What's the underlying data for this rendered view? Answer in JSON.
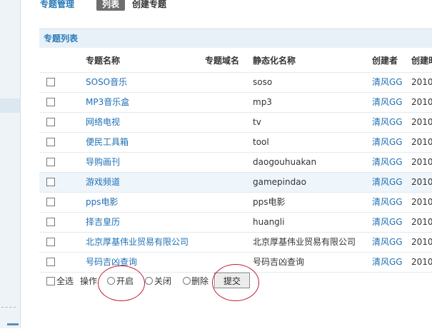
{
  "header": {
    "title": "专题管理",
    "tab_list": "列表",
    "tab_create": "创建专题"
  },
  "panel": {
    "title": "专题列表"
  },
  "table": {
    "columns": {
      "name": "专题名称",
      "domain": "专题域名",
      "static": "静态化名称",
      "creator": "创建者",
      "time": "创建时"
    },
    "rows": [
      {
        "name": "SOSO音乐",
        "domain": "",
        "static": "soso",
        "creator": "清风GG",
        "time": "2010"
      },
      {
        "name": "MP3音乐盒",
        "domain": "",
        "static": "mp3",
        "creator": "清风GG",
        "time": "2010"
      },
      {
        "name": "网络电视",
        "domain": "",
        "static": "tv",
        "creator": "清风GG",
        "time": "2010"
      },
      {
        "name": "便民工具箱",
        "domain": "",
        "static": "tool",
        "creator": "清风GG",
        "time": "2010"
      },
      {
        "name": "导购画刊",
        "domain": "",
        "static": "daogouhuakan",
        "creator": "清风GG",
        "time": "2010"
      },
      {
        "name": "游戏频道",
        "domain": "",
        "static": "gamepindao",
        "creator": "清风GG",
        "time": "2010"
      },
      {
        "name": "pps电影",
        "domain": "",
        "static": "pps电影",
        "creator": "清风GG",
        "time": "2010"
      },
      {
        "name": "择吉皇历",
        "domain": "",
        "static": "huangli",
        "creator": "清风GG",
        "time": "2010"
      },
      {
        "name": "北京厚基伟业贸易有限公司",
        "domain": "",
        "static": "北京厚基伟业贸易有限公司",
        "creator": "清风GG",
        "time": "2010"
      },
      {
        "name": "号码吉凶查询",
        "domain": "",
        "static": "号码吉凶查询",
        "creator": "清风GG",
        "time": "2010"
      }
    ]
  },
  "actions": {
    "select_all": "全选",
    "operation": "操作",
    "open": "开启",
    "close": "关闭",
    "delete": "删除",
    "submit": "提交"
  },
  "colors": {
    "link": "#1f6fb5",
    "header_text": "#2a7ab8",
    "annotation": "#c0203a"
  }
}
